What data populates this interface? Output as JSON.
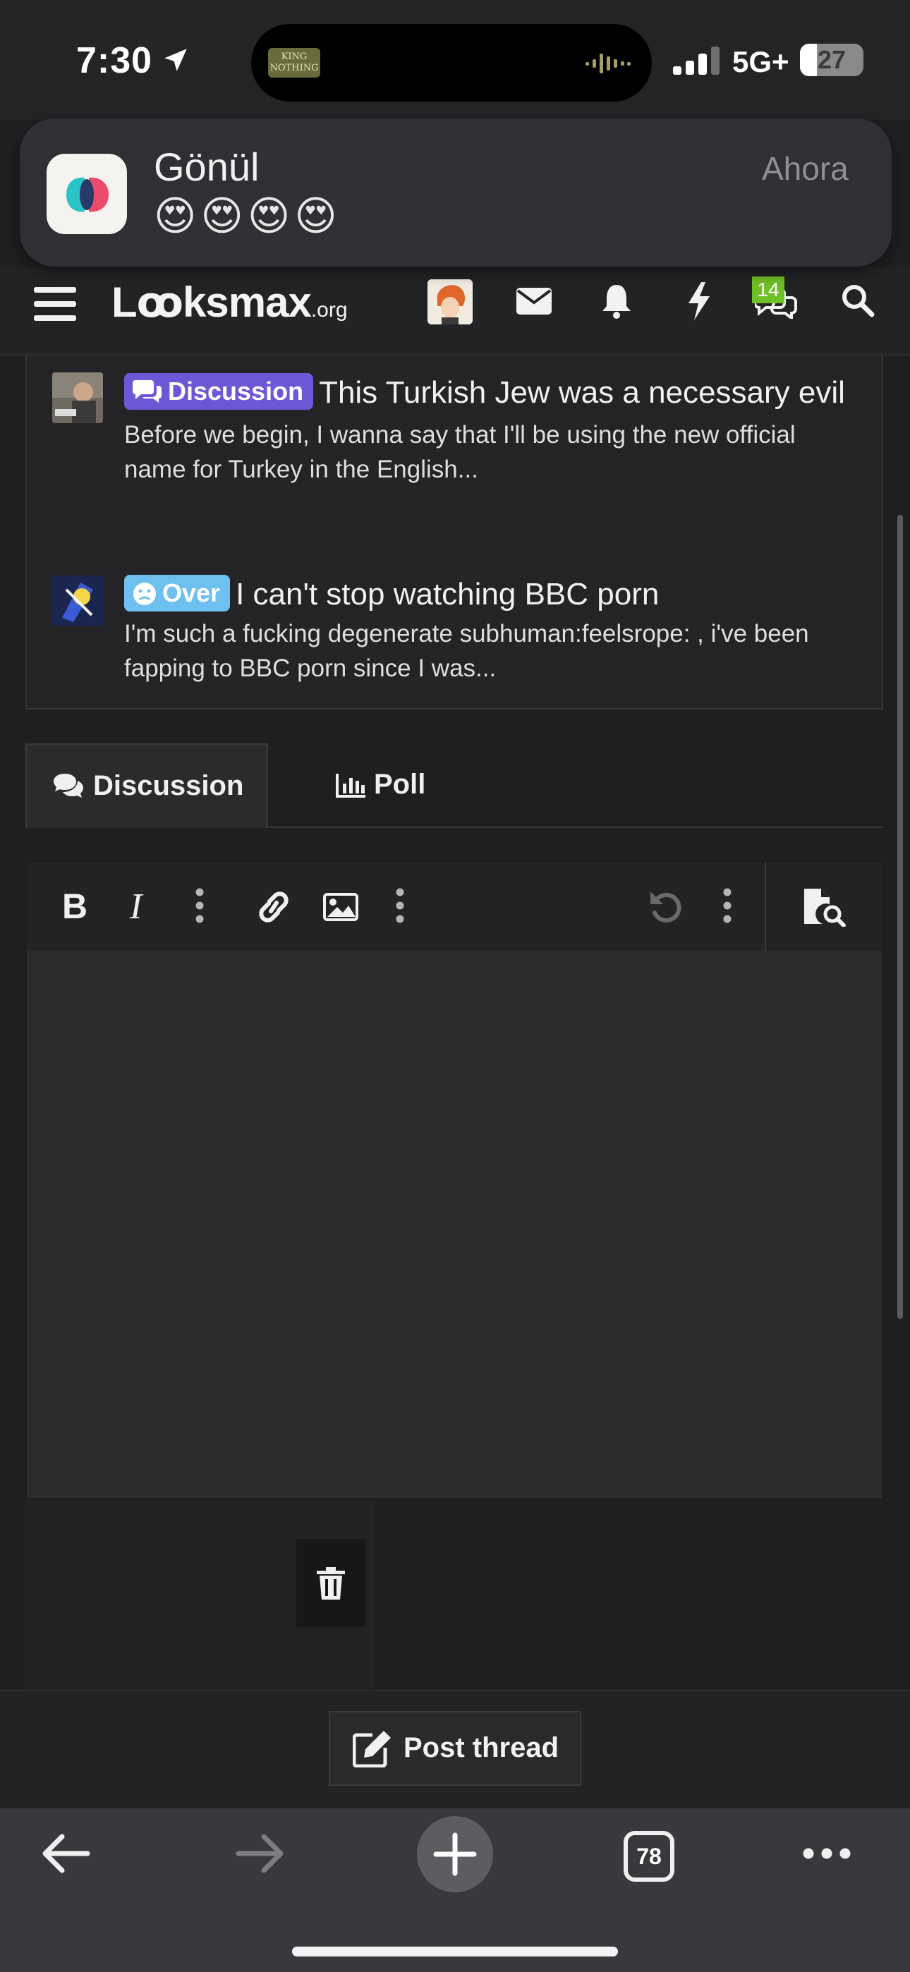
{
  "status_bar": {
    "time": "7:30",
    "island_thumb_text": "KING\nNOTHING",
    "network": "5G+",
    "battery": "27",
    "battery_level": 0.27
  },
  "notification": {
    "app_name": "Gönül",
    "message": "😍😍😍😍",
    "time": "Ahora"
  },
  "header": {
    "logo_main": "Lꝏksmax",
    "logo_suffix": ".org",
    "chat_badge": "14"
  },
  "threads": [
    {
      "prefix": "Discussion",
      "prefix_color": "#6a58d6",
      "title": "This Turkish Jew was a necessary evil",
      "snippet": "Before we begin, I wanna say that I'll be using the new official name for Turkey in the English..."
    },
    {
      "prefix": "Over",
      "prefix_color": "#6ec0ef",
      "title": "I can't stop watching BBC porn",
      "snippet": "I'm such a fucking degenerate subhuman:feelsrope: , i've been fapping to BBC porn since I was..."
    }
  ],
  "tabs": {
    "discussion": "Discussion",
    "poll": "Poll"
  },
  "editor": {
    "icons": [
      "bold-icon",
      "italic-icon",
      "more-vertical-icon",
      "link-icon",
      "image-icon",
      "more-vertical-icon",
      "undo-icon",
      "more-vertical-icon",
      "preview-icon"
    ]
  },
  "footer": {
    "post_button": "Post thread"
  },
  "browser": {
    "tab_count": "78"
  }
}
